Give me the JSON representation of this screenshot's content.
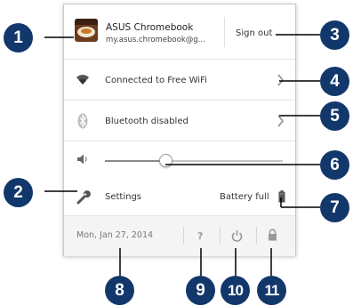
{
  "account": {
    "name": "ASUS Chromebook",
    "email": "my.asus.chromebook@g...",
    "sign_out_label": "Sign out"
  },
  "network": {
    "label": "Connected to Free WiFi",
    "icon": "wifi-icon"
  },
  "bluetooth": {
    "label": "Bluetooth disabled",
    "icon": "bluetooth-icon"
  },
  "volume": {
    "level": 0.34,
    "icon": "speaker-icon"
  },
  "settings": {
    "label": "Settings",
    "icon": "wrench-icon"
  },
  "battery": {
    "label": "Battery full",
    "icon": "battery-icon"
  },
  "footer": {
    "date": "Mon, Jan 27, 2014",
    "help_icon": "help-icon",
    "power_icon": "power-icon",
    "lock_icon": "lock-icon"
  },
  "callouts": [
    "1",
    "2",
    "3",
    "4",
    "5",
    "6",
    "7",
    "8",
    "9",
    "10",
    "11"
  ],
  "colors": {
    "callout": "#12376b",
    "text": "#333333",
    "muted": "#777777"
  }
}
